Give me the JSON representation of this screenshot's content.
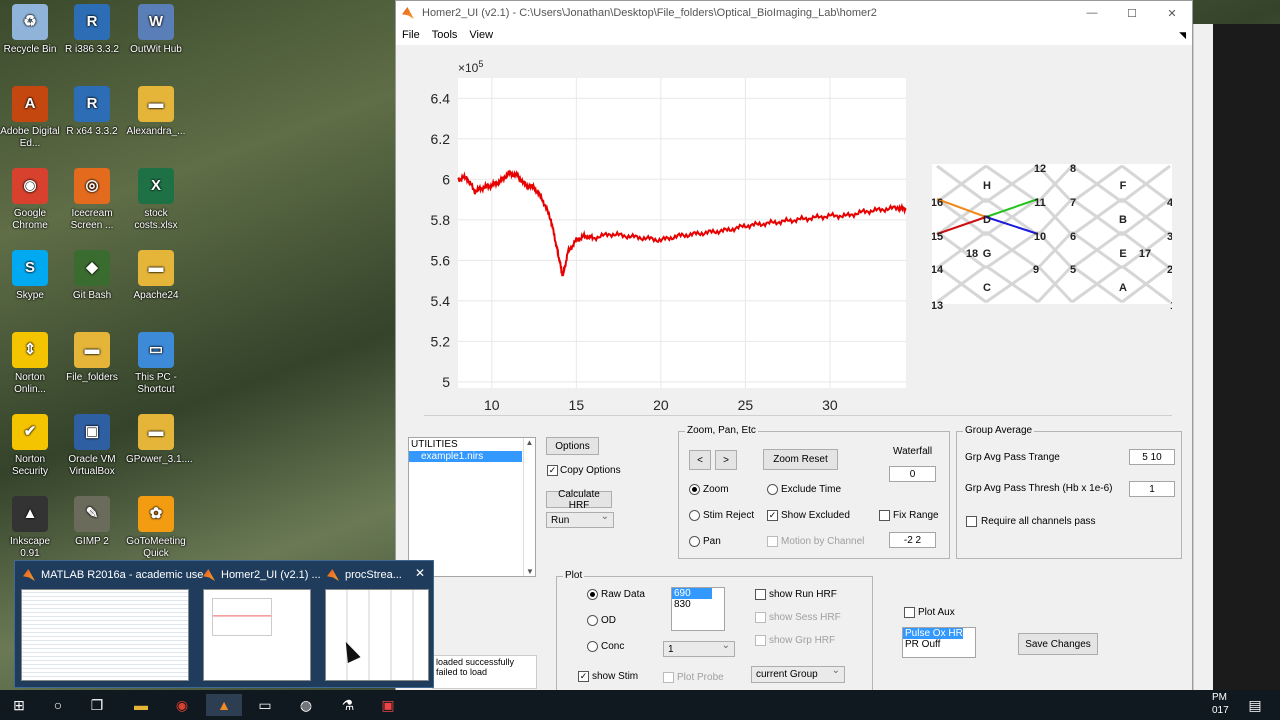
{
  "desktop": {
    "icons": [
      {
        "label": "Recycle Bin",
        "color": "#8fb3d9",
        "glyph": "♻"
      },
      {
        "label": "R i386 3.3.2",
        "color": "#2d6db5",
        "glyph": "R"
      },
      {
        "label": "OutWit Hub",
        "color": "#5a7fb8",
        "glyph": "W"
      },
      {
        "label": "Adobe Digital Ed...",
        "color": "#c4470f",
        "glyph": "A"
      },
      {
        "label": "R x64 3.3.2",
        "color": "#2d6db5",
        "glyph": "R"
      },
      {
        "label": "Alexandra_...",
        "color": "#e5b53a",
        "glyph": "▬"
      },
      {
        "label": "Google Chrome",
        "color": "#d9412f",
        "glyph": "◉"
      },
      {
        "label": "Icecream Screen ...",
        "color": "#e46b1e",
        "glyph": "◎"
      },
      {
        "label": "stock costs.xlsx",
        "color": "#1e7145",
        "glyph": "X"
      },
      {
        "label": "Skype",
        "color": "#00a9f0",
        "glyph": "S"
      },
      {
        "label": "Git Bash",
        "color": "#3a6b2f",
        "glyph": "◆"
      },
      {
        "label": "Apache24",
        "color": "#e5b53a",
        "glyph": "▬"
      },
      {
        "label": "Norton Onlin...",
        "color": "#f5c400",
        "glyph": "⇕"
      },
      {
        "label": "File_folders",
        "color": "#e5b53a",
        "glyph": "▬"
      },
      {
        "label": "This PC - Shortcut",
        "color": "#3c8ad8",
        "glyph": "▭"
      },
      {
        "label": "Norton Security",
        "color": "#f5c400",
        "glyph": "✔"
      },
      {
        "label": "Oracle VM VirtualBox",
        "color": "#2f5fa3",
        "glyph": "▣"
      },
      {
        "label": "GPower_3.1....",
        "color": "#e5b53a",
        "glyph": "▬"
      },
      {
        "label": "Inkscape 0.91",
        "color": "#333333",
        "glyph": "▲"
      },
      {
        "label": "GIMP 2",
        "color": "#6b6b5b",
        "glyph": "✎"
      },
      {
        "label": "GoToMeeting Quick Conn...",
        "color": "#f39c12",
        "glyph": "✿"
      }
    ]
  },
  "window": {
    "title": "Homer2_UI  (v2.1)  -  C:\\Users\\Jonathan\\Desktop\\File_folders\\Optical_BioImaging_Lab\\homer2",
    "controls": {
      "minimize": "—",
      "maximize": "☐",
      "close": "✕"
    },
    "menu": [
      "File",
      "Tools",
      "View"
    ]
  },
  "chart_data": {
    "type": "line",
    "title": "",
    "xlabel": "",
    "ylabel": "",
    "exponent_label": "×10",
    "exponent_power": "5",
    "xlim": [
      8,
      34.5
    ],
    "ylim": [
      4.97,
      6.5
    ],
    "xticks": [
      10,
      15,
      20,
      25,
      30
    ],
    "yticks": [
      5,
      5.2,
      5.4,
      5.6,
      5.8,
      6,
      6.2,
      6.4
    ],
    "series": [
      {
        "color": "#e60000",
        "x": [
          8.0,
          8.5,
          9.0,
          9.5,
          10.0,
          10.5,
          11.0,
          11.5,
          12.0,
          12.5,
          13.0,
          13.5,
          13.8,
          14.0,
          14.2,
          14.5,
          15.0,
          15.5,
          16.0,
          17.0,
          18.0,
          19.0,
          20.0,
          21.0,
          22.0,
          23.0,
          24.0,
          25.0,
          26.0,
          27.0,
          28.0,
          29.0,
          30.0,
          31.0,
          32.0,
          33.0,
          34.0,
          34.5
        ],
        "y": [
          6.0,
          6.01,
          5.94,
          5.96,
          5.97,
          5.99,
          6.03,
          6.02,
          5.97,
          5.96,
          5.9,
          5.8,
          5.68,
          5.6,
          5.52,
          5.64,
          5.7,
          5.72,
          5.71,
          5.73,
          5.72,
          5.71,
          5.7,
          5.72,
          5.73,
          5.74,
          5.75,
          5.77,
          5.78,
          5.79,
          5.8,
          5.81,
          5.82,
          5.82,
          5.84,
          5.85,
          5.86,
          5.85
        ]
      }
    ]
  },
  "probe": {
    "labels": [
      {
        "t": "12"
      },
      {
        "t": "8"
      },
      {
        "t": "H"
      },
      {
        "t": "F"
      },
      {
        "t": "16"
      },
      {
        "t": "11"
      },
      {
        "t": "7"
      },
      {
        "t": "4"
      },
      {
        "t": "D"
      },
      {
        "t": "B"
      },
      {
        "t": "15"
      },
      {
        "t": "10"
      },
      {
        "t": "6"
      },
      {
        "t": "3"
      },
      {
        "t": "18"
      },
      {
        "t": "G"
      },
      {
        "t": "E"
      },
      {
        "t": "17"
      },
      {
        "t": "14"
      },
      {
        "t": "9"
      },
      {
        "t": "5"
      },
      {
        "t": "2"
      },
      {
        "t": "C"
      },
      {
        "t": "A"
      },
      {
        "t": "13"
      },
      {
        "t": "1"
      }
    ],
    "highlight_colors": [
      "#f08c1e",
      "#26c21e",
      "#1a1adb",
      "#cc1010"
    ]
  },
  "files": {
    "header": "UTILITIES",
    "items": [
      "example1.nirs"
    ],
    "options_button": "Options",
    "copy_options": "Copy Options",
    "calc_hrf": "Calculate HRF",
    "run_select": "Run"
  },
  "status": {
    "line1": "loaded successfully",
    "line2": "failed to load"
  },
  "zoom": {
    "title": "Zoom, Pan, Etc",
    "prev": "<",
    "next": ">",
    "zoom_reset": "Zoom Reset",
    "waterfall_label": "Waterfall",
    "waterfall_value": "0",
    "zoom": "Zoom",
    "exclude_time": "Exclude Time",
    "stim_reject": "Stim Reject",
    "show_excluded": "Show Excluded",
    "fix_range": "Fix Range",
    "pan": "Pan",
    "motion": "Motion by Channel",
    "range_value": "-2 2"
  },
  "group": {
    "title": "Group Average",
    "trange_label": "Grp Avg Pass Trange",
    "trange_value": "5 10",
    "thresh_label": "Grp Avg Pass Thresh (Hb x 1e-6)",
    "thresh_value": "1",
    "require_all": "Require all channels pass"
  },
  "plot": {
    "title": "Plot",
    "raw": "Raw Data",
    "od": "OD",
    "conc": "Conc",
    "wavelengths": [
      "690",
      "830"
    ],
    "conc_select": "1",
    "show_stim": "show Stim",
    "plot_probe": "Plot Probe",
    "show_run_hrf": "show Run HRF",
    "show_sess_hrf": "show Sess HRF",
    "show_grp_hrf": "show Grp HRF",
    "group_select": "current Group"
  },
  "aux": {
    "plot_aux": "Plot Aux",
    "items": [
      "Pulse Ox HR",
      "PR Ouff"
    ],
    "save_changes": "Save Changes"
  },
  "taskbar": {
    "previews": [
      {
        "label": "MATLAB R2016a - academic use"
      },
      {
        "label": "Homer2_UI  (v2.1) ..."
      },
      {
        "label": "procStrea..."
      }
    ],
    "preview_close": "✕",
    "clock_line1": "PM",
    "clock_line2": "017"
  }
}
